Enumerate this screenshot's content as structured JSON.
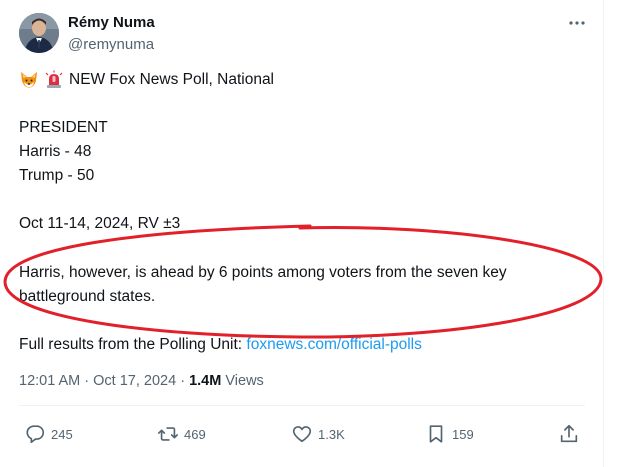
{
  "author": {
    "display_name": "Rémy Numa",
    "handle": "@remynuma"
  },
  "tweet": {
    "emojis": [
      "fox-face",
      "police-car-light"
    ],
    "headline": "NEW Fox News Poll, National",
    "section_title": "PRESIDENT",
    "results": [
      "Harris - 48",
      "Trump - 50"
    ],
    "poll_details": "Oct 11-14, 2024, RV ±3",
    "note_line1": "Harris, however, is ahead by 6 points among voters from the seven key",
    "note_line2": "battleground states.",
    "full_results_text": "Full results from the Polling Unit:",
    "link_text": "foxnews.com/official-polls"
  },
  "meta": {
    "timestamp": "12:01 AM · Oct 17, 2024",
    "separator": "·",
    "views_count": "1.4M",
    "views_label": "Views"
  },
  "actions": {
    "replies": "245",
    "reposts": "469",
    "likes": "1.3K",
    "bookmarks": "159"
  },
  "colors": {
    "link": "#1d9bf0",
    "muted": "#536471",
    "annotation": "#e2202a"
  }
}
